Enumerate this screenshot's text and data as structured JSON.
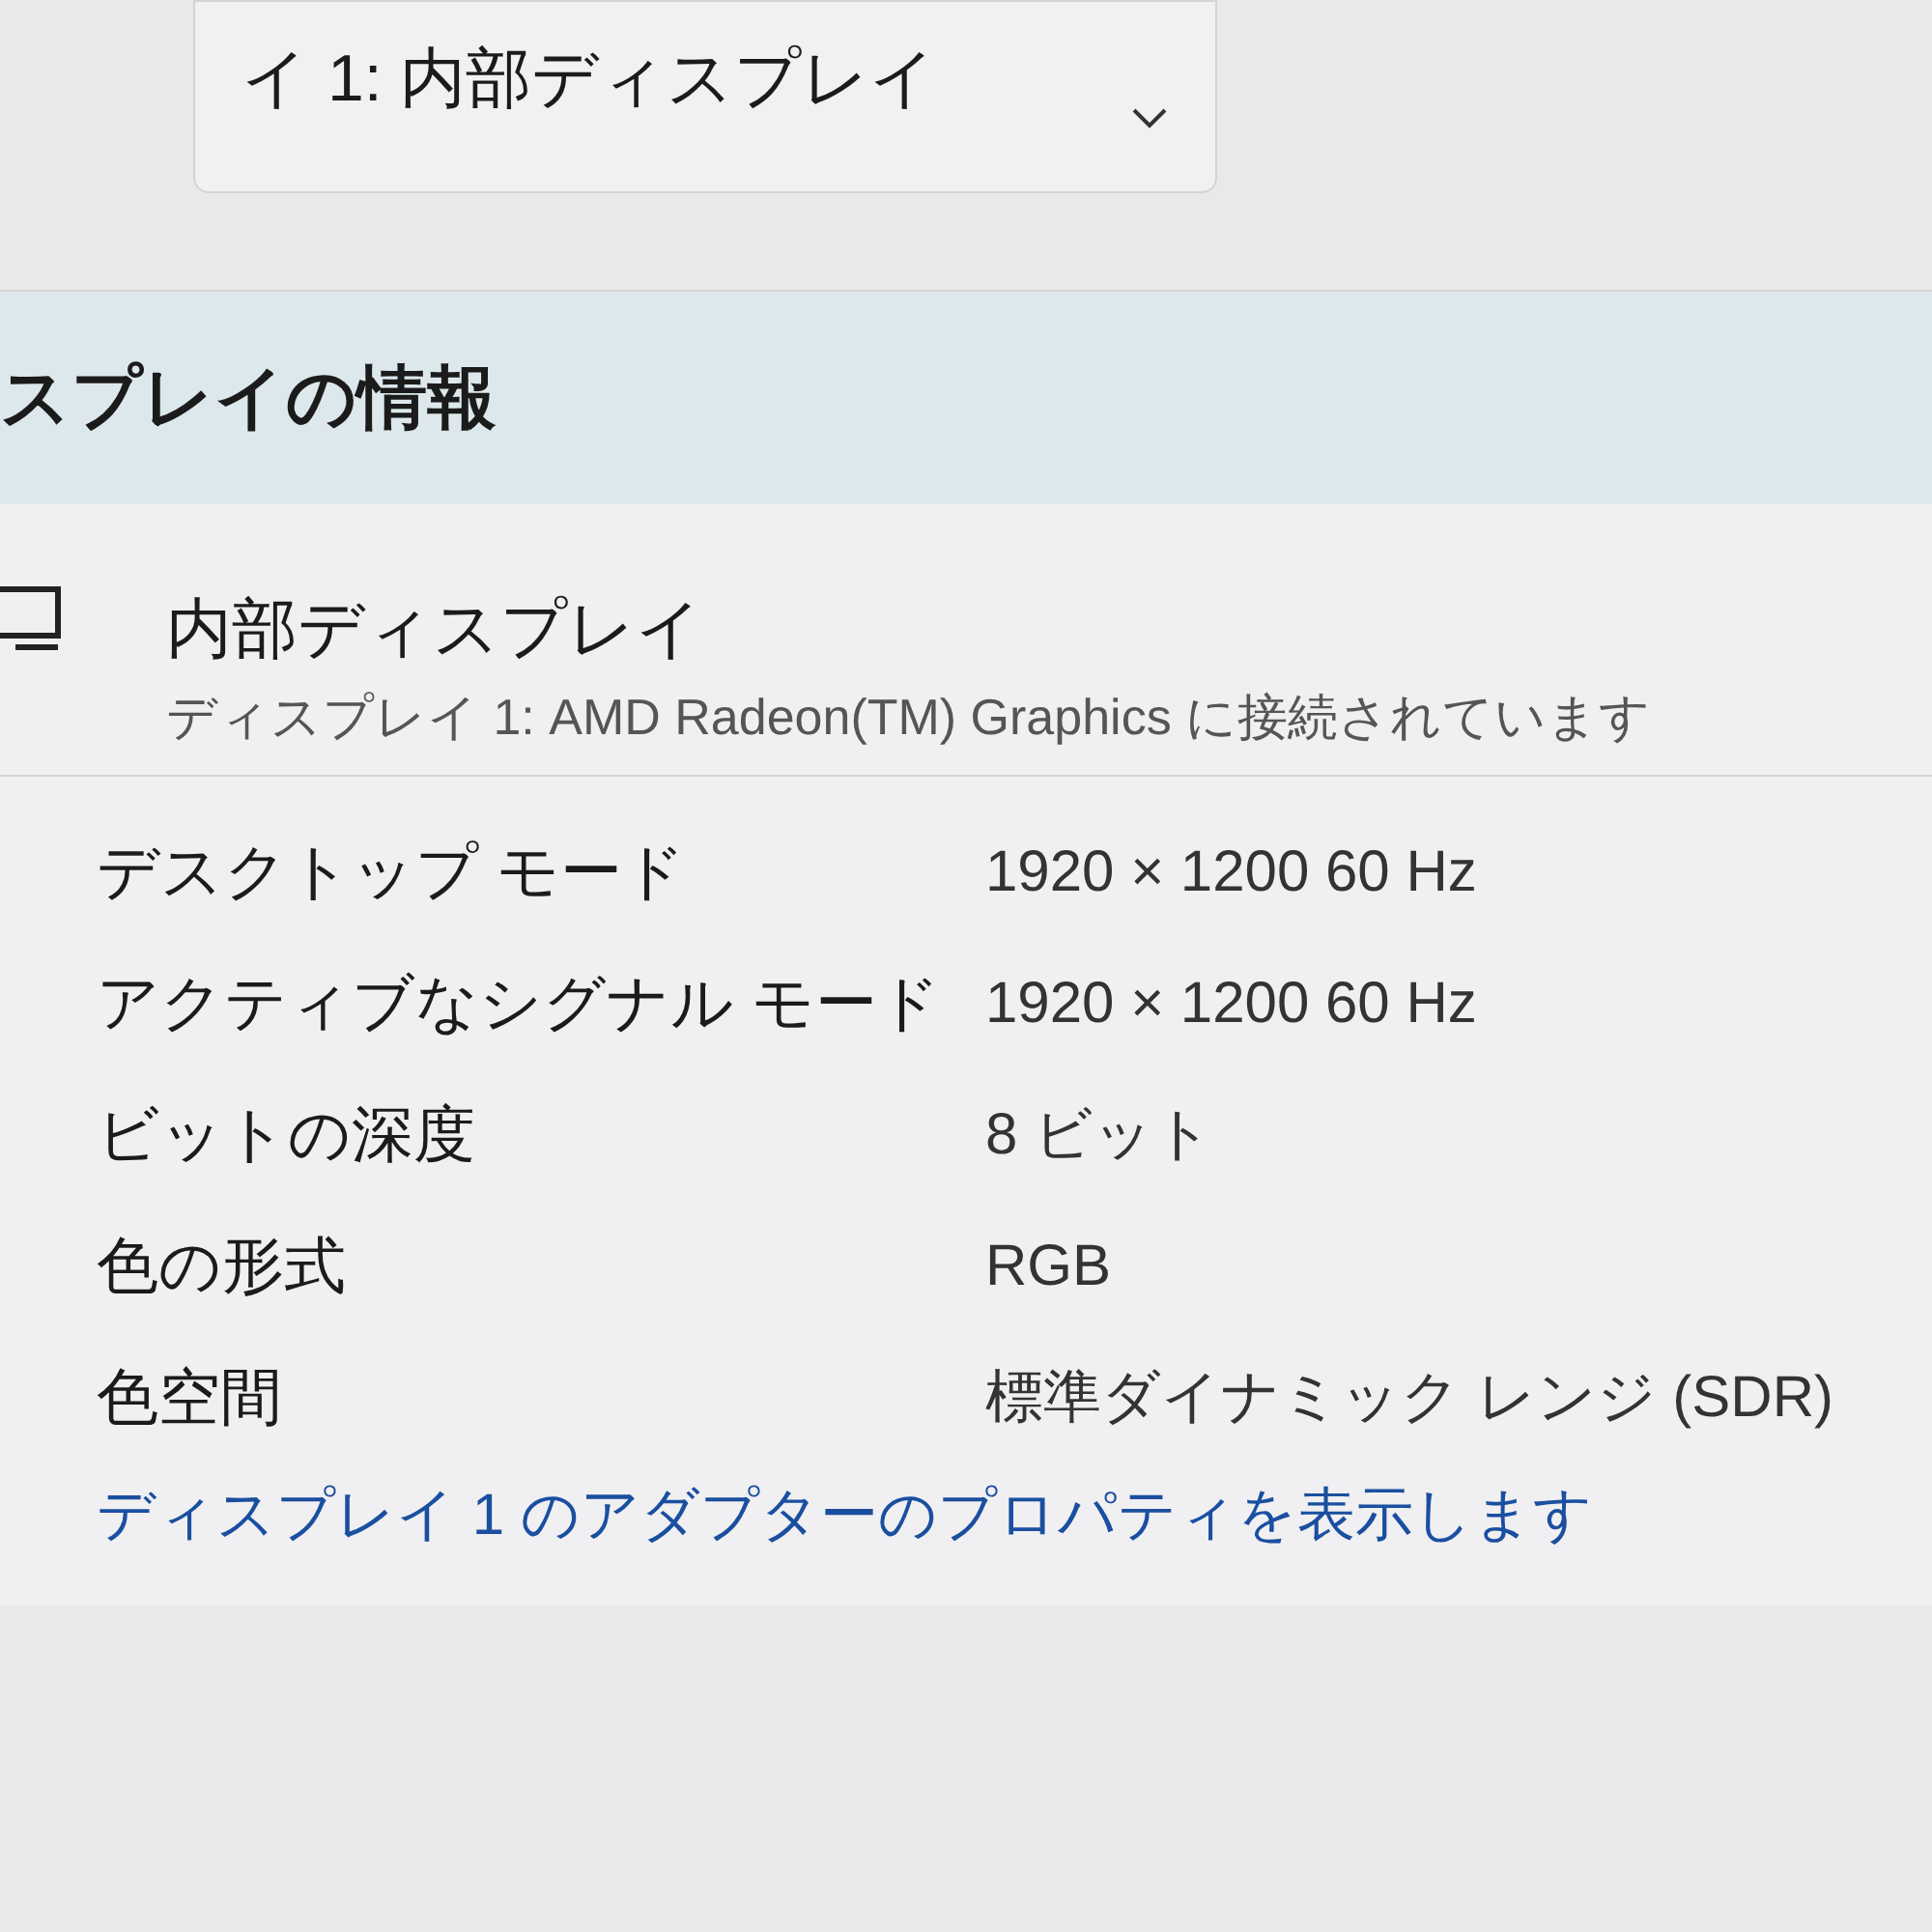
{
  "display_select": {
    "value": "イ 1: 内部ディスプレイ"
  },
  "info": {
    "title": "スプレイの情報",
    "display_name": "内部ディスプレイ",
    "connection": "ディスプレイ 1: AMD Radeon(TM) Graphics に接続されています",
    "rows": [
      {
        "label": "デスクトップ モード",
        "value": "1920 × 1200 60 Hz"
      },
      {
        "label": "アクティブなシグナル モード",
        "value": "1920 × 1200 60 Hz"
      },
      {
        "label": "ビットの深度",
        "value": "8 ビット"
      },
      {
        "label": "色の形式",
        "value": "RGB"
      },
      {
        "label": "色空間",
        "value": "標準ダイナミック レンジ (SDR)"
      }
    ],
    "link": "ディスプレイ 1 のアダプターのプロパティを表示します"
  }
}
